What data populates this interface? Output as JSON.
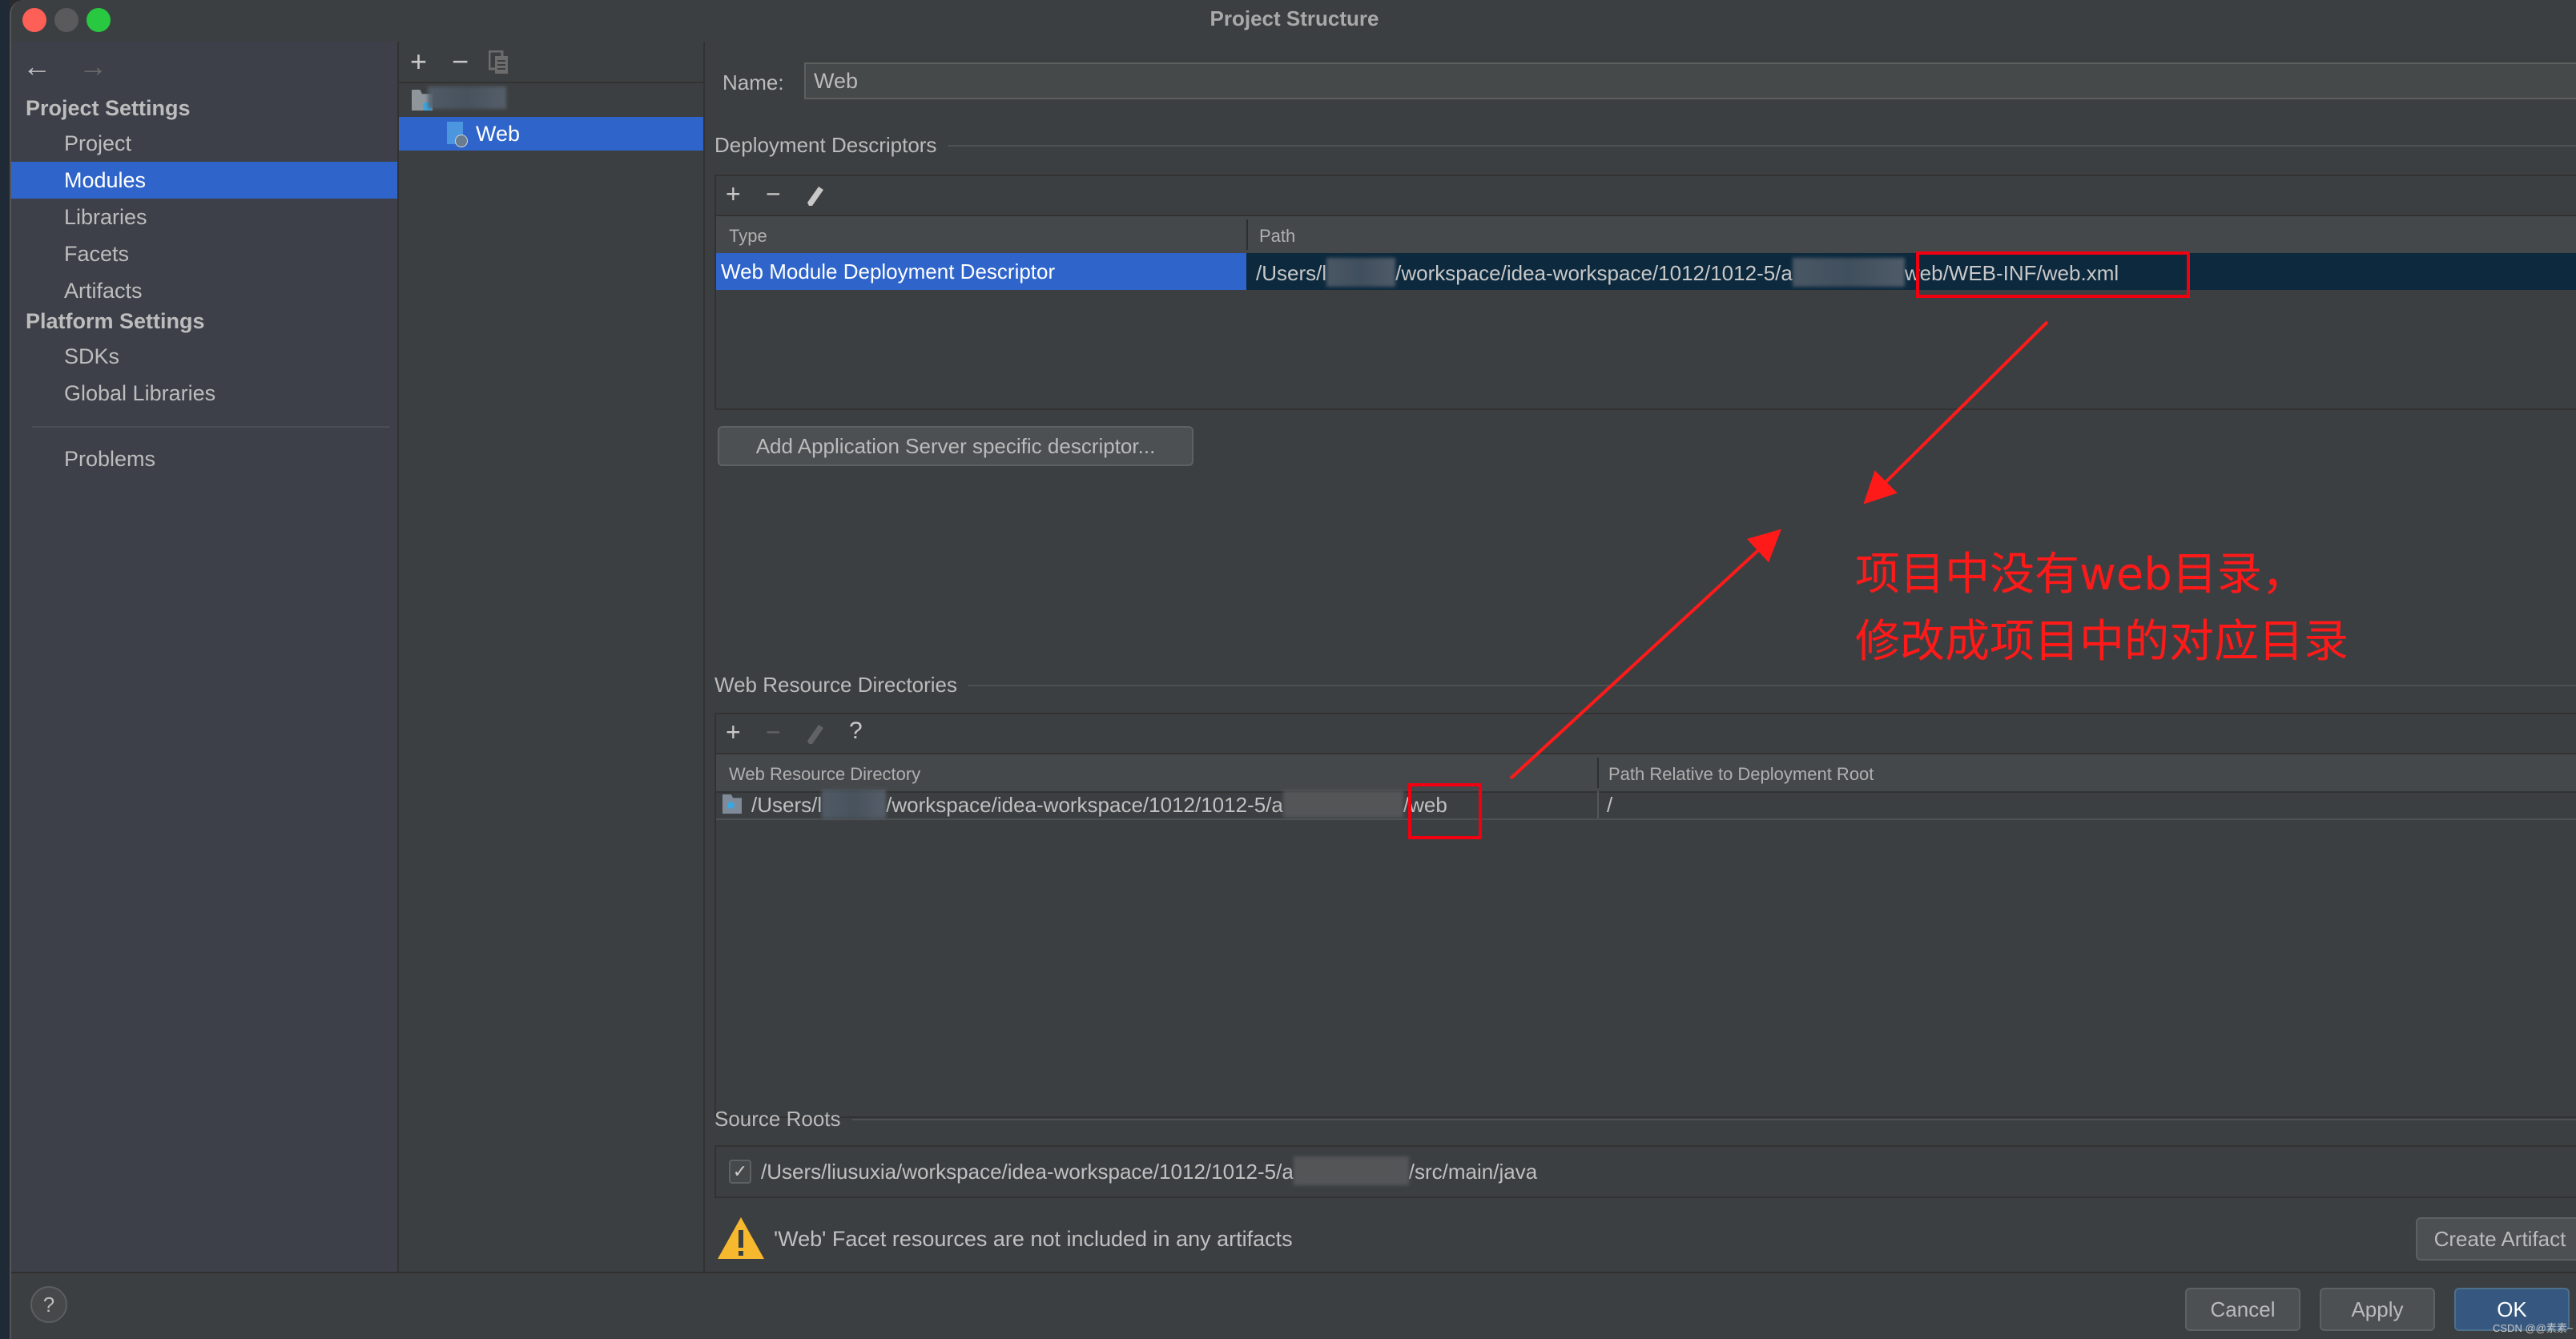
{
  "window": {
    "title": "Project Structure"
  },
  "sidebar": {
    "back_icon": "←",
    "forward_icon": "→",
    "sections": [
      {
        "title": "Project Settings",
        "items": [
          {
            "label": "Project",
            "selected": false
          },
          {
            "label": "Modules",
            "selected": true
          },
          {
            "label": "Libraries",
            "selected": false
          },
          {
            "label": "Facets",
            "selected": false
          },
          {
            "label": "Artifacts",
            "selected": false
          }
        ]
      },
      {
        "title": "Platform Settings",
        "items": [
          {
            "label": "SDKs",
            "selected": false
          },
          {
            "label": "Global Libraries",
            "selected": false
          }
        ]
      }
    ],
    "problems_label": "Problems",
    "help_label": "?"
  },
  "tree": {
    "toolbar": {
      "add": "+",
      "remove": "−",
      "copy_icon": "copy-icon"
    },
    "root_label_redacted": true,
    "selected_item": "Web"
  },
  "main": {
    "name_label": "Name:",
    "name_value": "Web",
    "deployment_descriptors": {
      "title": "Deployment Descriptors",
      "toolbar": {
        "add": "+",
        "remove": "−",
        "edit_icon": "pencil-icon"
      },
      "columns": [
        "Type",
        "Path"
      ],
      "rows": [
        {
          "type": "Web Module Deployment Descriptor",
          "path_prefix": "/Users/l",
          "path_mid": "/workspace/idea-workspace/1012/1012-5/a",
          "path_highlight": "web/WEB-INF/web.xml"
        }
      ],
      "add_server_descriptor_button": "Add Application Server specific descriptor..."
    },
    "web_resource_directories": {
      "title": "Web Resource Directories",
      "toolbar": {
        "add": "+",
        "remove": "−",
        "edit_icon": "pencil-icon",
        "help": "?"
      },
      "columns": [
        "Web Resource Directory",
        "Path Relative to Deployment Root"
      ],
      "rows": [
        {
          "dir_prefix": "/Users/l",
          "dir_mid": "/workspace/idea-workspace/1012/1012-5/a",
          "dir_highlight": "/web",
          "relative_path": "/"
        }
      ]
    },
    "source_roots": {
      "title": "Source Roots",
      "rows": [
        {
          "checked": true,
          "path_prefix": "/Users/liusuxia/workspace/idea-workspace/1012/1012-5/a",
          "path_suffix": "/src/main/java"
        }
      ]
    },
    "warning": {
      "text": "'Web' Facet resources are not included in any artifacts",
      "button": "Create Artifact"
    }
  },
  "footer": {
    "cancel": "Cancel",
    "apply": "Apply",
    "ok": "OK",
    "watermark": "CSDN @@素素~"
  },
  "annotation": {
    "line1": "项目中没有web目录，",
    "line2": "修改成项目中的对应目录",
    "color": "#ff1a1a"
  },
  "colors": {
    "selection": "#2f65ca",
    "selected_row_dark": "#0d293e",
    "ok_button": "#365880",
    "warning": "#f5b82e"
  }
}
